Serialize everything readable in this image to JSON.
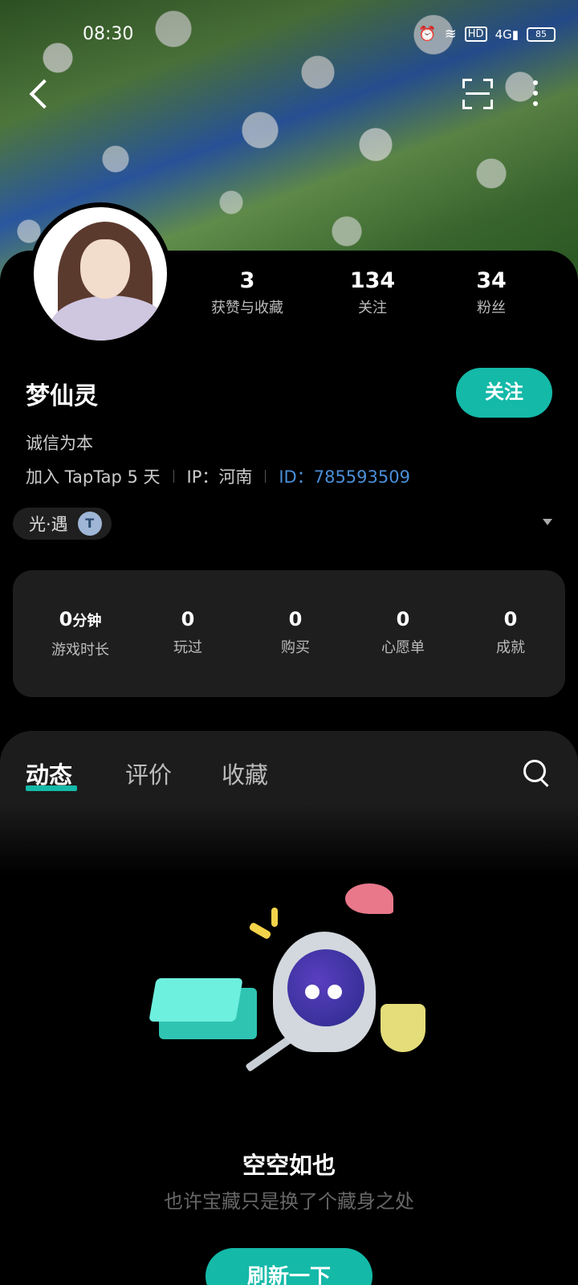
{
  "status_bar": {
    "time": "08:30",
    "battery": "85",
    "network": "4G",
    "hd_label": "HD"
  },
  "profile": {
    "name": "梦仙灵",
    "follow_button": "关注",
    "bio": "诚信为本",
    "joined": "加入 TapTap 5 天",
    "ip": "IP：河南",
    "id": "ID：785593509",
    "stats": [
      {
        "value": "3",
        "label": "获赞与收藏"
      },
      {
        "value": "134",
        "label": "关注"
      },
      {
        "value": "34",
        "label": "粉丝"
      }
    ],
    "badge": {
      "label": "光·遇",
      "icon": "T"
    }
  },
  "game_stats": [
    {
      "value": "0",
      "unit": "分钟",
      "label": "游戏时长"
    },
    {
      "value": "0",
      "unit": "",
      "label": "玩过"
    },
    {
      "value": "0",
      "unit": "",
      "label": "购买"
    },
    {
      "value": "0",
      "unit": "",
      "label": "心愿单"
    },
    {
      "value": "0",
      "unit": "",
      "label": "成就"
    }
  ],
  "tabs": [
    {
      "label": "动态",
      "active": true
    },
    {
      "label": "评价",
      "active": false
    },
    {
      "label": "收藏",
      "active": false
    }
  ],
  "empty_state": {
    "title": "空空如也",
    "subtitle": "也许宝藏只是换了个藏身之处",
    "button": "刷新一下"
  },
  "colors": {
    "accent": "#14b9a8",
    "link": "#4a8fd8",
    "background": "#000000",
    "panel": "#1e1e1e"
  }
}
